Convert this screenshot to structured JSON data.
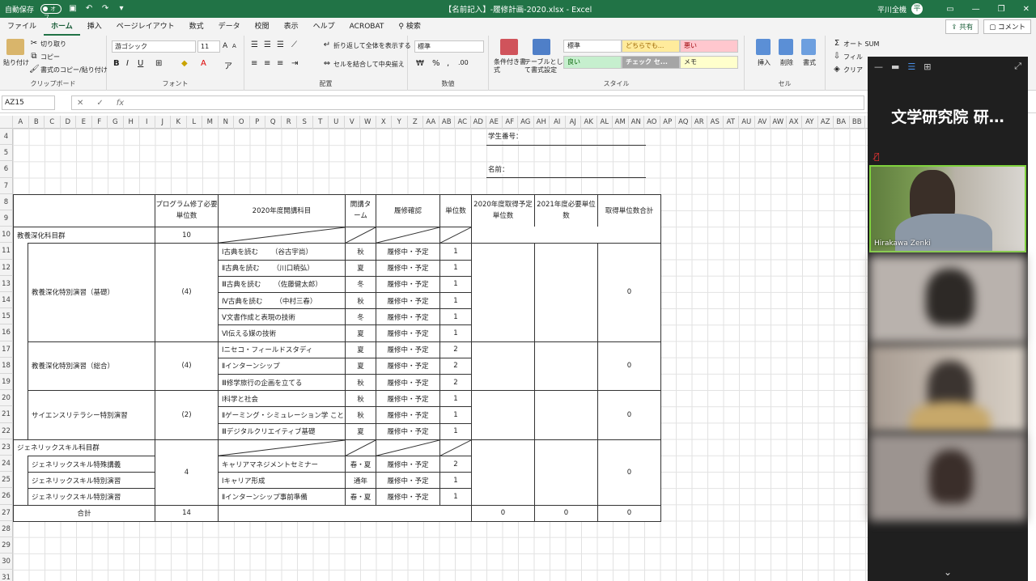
{
  "titlebar": {
    "autosave": "自動保存",
    "toggle": "オフ",
    "title": "【名前記入】-履修計画-2020.xlsx  -  Excel",
    "user": "平川全機",
    "user_initial": "平"
  },
  "menu": [
    "ファイル",
    "ホーム",
    "挿入",
    "ページレイアウト",
    "数式",
    "データ",
    "校閲",
    "表示",
    "ヘルプ",
    "ACROBAT",
    "検索"
  ],
  "menu_active": 1,
  "menu_right": {
    "share": "共有",
    "comment": "コメント"
  },
  "ribbon": {
    "clipboard": {
      "paste": "貼り付け",
      "cut": "切り取り",
      "copy": "コピー",
      "format_painter": "書式のコピー/貼り付け",
      "label": "クリップボード"
    },
    "font": {
      "name": "游ゴシック",
      "size": "11",
      "label": "フォント",
      "bold": "B",
      "italic": "I",
      "underline": "U",
      "grow": "A",
      "shrink": "A"
    },
    "align": {
      "wrap": "折り返して全体を表示する",
      "merge": "セルを結合して中央揃え",
      "label": "配置"
    },
    "number": {
      "format": "標準",
      "label": "数値"
    },
    "styles": {
      "cond": "条件付き書式",
      "table": "テーブルとして書式設定",
      "cells": [
        "標準",
        "どちらでも...",
        "悪い",
        "良い",
        "チェック セ...",
        "メモ"
      ],
      "label": "スタイル"
    },
    "cells": {
      "insert": "挿入",
      "delete": "削除",
      "format": "書式",
      "label": "セル"
    },
    "edit": {
      "autosum": "オート SUM",
      "fill": "フィル",
      "clear": "クリア"
    }
  },
  "namebox": "AZ15",
  "columns": [
    "A",
    "B",
    "C",
    "D",
    "E",
    "F",
    "G",
    "H",
    "I",
    "J",
    "K",
    "L",
    "M",
    "N",
    "O",
    "P",
    "Q",
    "R",
    "S",
    "T",
    "U",
    "V",
    "W",
    "X",
    "Y",
    "Z",
    "AA",
    "AB",
    "AC",
    "AD",
    "AE",
    "AF",
    "AG",
    "AH",
    "AI",
    "AJ",
    "AK",
    "AL",
    "AM",
    "AN",
    "AO",
    "AP",
    "AQ",
    "AR",
    "AS",
    "AT",
    "AU",
    "AV",
    "AW",
    "AX",
    "AY",
    "AZ",
    "BA",
    "BB"
  ],
  "rows": [
    "4",
    "5",
    "6",
    "7",
    "8",
    "9",
    "10",
    "11",
    "12",
    "13",
    "14",
    "15",
    "16",
    "17",
    "18",
    "19",
    "20",
    "21",
    "22",
    "23",
    "24",
    "25",
    "26",
    "27",
    "28",
    "29",
    "30",
    "31"
  ],
  "sheet": {
    "student_no": "学生番号：",
    "name": "名前：",
    "headers": {
      "req": "プログラム修了必要単位数",
      "subject": "2020年度開講科目",
      "term": "開講ターム",
      "confirm": "履修確認",
      "credits": "単位数",
      "plan2020": "2020年度取得予定単位数",
      "need2021": "2021年度必要単位数",
      "total": "取得単位数合計"
    },
    "group1": {
      "name": "教養深化科目群",
      "req": "10"
    },
    "sub_basic": {
      "name": "教養深化特別演習（基礎）",
      "req": "(4)",
      "total": "0"
    },
    "sub_general": {
      "name": "教養深化特別演習（総合）",
      "req": "(4)",
      "total": "0"
    },
    "sub_science": {
      "name": "サイエンスリテラシー特別演習",
      "req": "(2)",
      "total": "0"
    },
    "group2": {
      "name": "ジェネリックスキル科目群",
      "req": "4",
      "total": "0"
    },
    "generic_names": [
      "ジェネリックスキル特殊講義",
      "ジェネリックスキル特別演習",
      "ジェネリックスキル特別演習"
    ],
    "courses": [
      {
        "title": "Ⅰ古典を読む",
        "teacher": "（谷古宇尚）",
        "term": "秋",
        "status": "履修中・予定",
        "credits": "1"
      },
      {
        "title": "Ⅱ古典を読む",
        "teacher": "（川口暁弘）",
        "term": "夏",
        "status": "履修中・予定",
        "credits": "1"
      },
      {
        "title": "Ⅲ古典を読む",
        "teacher": "（佐藤健太郎）",
        "term": "冬",
        "status": "履修中・予定",
        "credits": "1"
      },
      {
        "title": "Ⅳ古典を読む",
        "teacher": "（中村三春）",
        "term": "秋",
        "status": "履修中・予定",
        "credits": "1"
      },
      {
        "title": "Ⅴ文書作成と表現の技術",
        "teacher": "",
        "term": "冬",
        "status": "履修中・予定",
        "credits": "1"
      },
      {
        "title": "Ⅵ伝える媒の技術",
        "teacher": "",
        "term": "夏",
        "status": "履修中・予定",
        "credits": "1"
      },
      {
        "title": "Ⅰニセコ・フィールドスタディ",
        "teacher": "",
        "term": "夏",
        "status": "履修中・予定",
        "credits": "2"
      },
      {
        "title": "Ⅱインターンシップ",
        "teacher": "",
        "term": "夏",
        "status": "履修中・予定",
        "credits": "2"
      },
      {
        "title": "Ⅲ修学旅行の企画を立てる",
        "teacher": "",
        "term": "秋",
        "status": "履修中・予定",
        "credits": "2"
      },
      {
        "title": "Ⅰ科学と社会",
        "teacher": "",
        "term": "秋",
        "status": "履修中・予定",
        "credits": "1"
      },
      {
        "title": "Ⅱゲーミング・シミュレーション学 ことはじめ",
        "teacher": "",
        "term": "秋",
        "status": "履修中・予定",
        "credits": "1"
      },
      {
        "title": "Ⅲデジタルクリエイティブ基礎",
        "teacher": "",
        "term": "夏",
        "status": "履修中・予定",
        "credits": "1"
      },
      {
        "title": "キャリアマネジメントセミナー",
        "teacher": "",
        "term": "春・夏",
        "status": "履修中・予定",
        "credits": "2"
      },
      {
        "title": "Ⅰキャリア形成",
        "teacher": "",
        "term": "通年",
        "status": "履修中・予定",
        "credits": "1"
      },
      {
        "title": "Ⅱインターンシップ事前準備",
        "teacher": "",
        "term": "春・夏",
        "status": "履修中・予定",
        "credits": "1"
      }
    ],
    "total_row": {
      "label": "合計",
      "req": "14",
      "plan2020": "0",
      "need2021": "0",
      "total": "0"
    }
  },
  "zoom": {
    "title": "文学研究院 研…",
    "participant1": "Hirakawa Zenki"
  }
}
